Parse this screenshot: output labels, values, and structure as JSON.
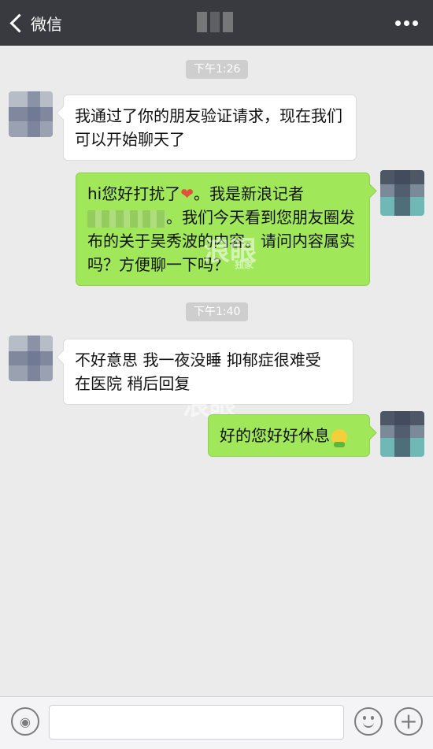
{
  "header": {
    "back_label": "微信",
    "icons": {
      "back": "chevron-left-icon",
      "more": "more-dots-icon"
    }
  },
  "messages": [
    {
      "type": "time",
      "text": "下午1:26"
    },
    {
      "type": "in",
      "text": "我通过了你的朋友验证请求，现在我们可以开始聊天了"
    },
    {
      "type": "out",
      "parts": [
        "hi您好打扰了",
        "❤",
        "。我是新浪记者",
        "。我们今天看到您朋友圈发布的关于吴秀波的内容。请问内容属实吗？方便聊一下吗？"
      ]
    },
    {
      "type": "time",
      "text": "下午1:40"
    },
    {
      "type": "in",
      "text": "不好意思 我一夜没睡 抑郁症很难受 在医院 稍后回复"
    },
    {
      "type": "out",
      "text": "好的您好好休息"
    }
  ],
  "watermark": {
    "big": "浪眼",
    "small": "独家"
  },
  "input_bar": {
    "value": "",
    "icons": {
      "voice": "voice-icon",
      "emoji": "emoji-icon",
      "plus": "plus-icon"
    }
  },
  "colors": {
    "header_bg": "#393a3f",
    "chat_bg": "#ebebeb",
    "out_bubble": "#a0e75a",
    "in_bubble": "#ffffff"
  }
}
